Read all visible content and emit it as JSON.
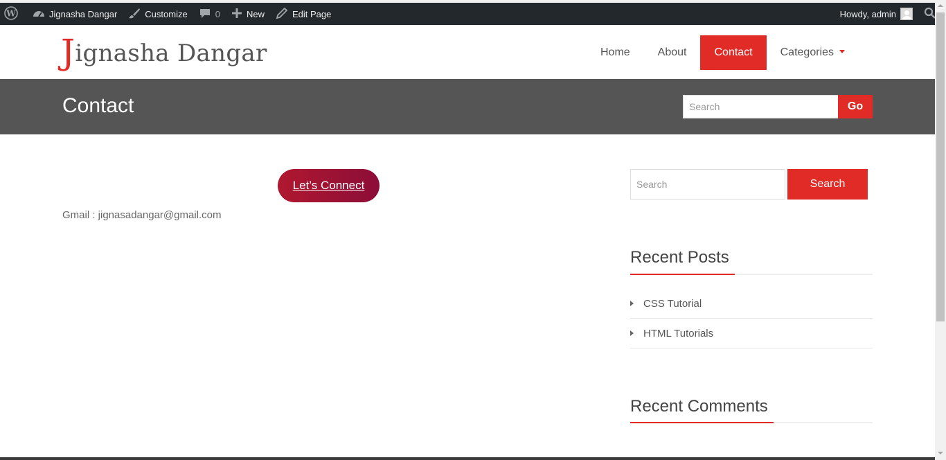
{
  "admin_bar": {
    "site_name": "Jignasha Dangar",
    "customize": "Customize",
    "comments_count": "0",
    "new_label": "New",
    "edit_page": "Edit Page",
    "howdy": "Howdy, admin"
  },
  "header": {
    "logo_first": "J",
    "logo_rest": "ignasha Dangar",
    "nav": [
      {
        "label": "Home"
      },
      {
        "label": "About"
      },
      {
        "label": "Contact",
        "active": true
      },
      {
        "label": "Categories"
      }
    ]
  },
  "title_bar": {
    "title": "Contact",
    "search_placeholder": "Search",
    "go_label": "Go"
  },
  "content": {
    "connect_label": "Let’s Connect",
    "gmail_text": "Gmail : jignasadangar@gmail.com"
  },
  "sidebar": {
    "search_placeholder": "Search",
    "search_button": "Search",
    "recent_posts_title": "Recent Posts",
    "recent_posts": [
      "CSS Tutorial",
      "HTML Tutorials"
    ],
    "recent_comments_title": "Recent Comments"
  },
  "colors": {
    "accent": "#e02b27",
    "admin_bar": "#23282d",
    "title_bar": "#555555",
    "connect_gradient_start": "#b0182f",
    "connect_gradient_end": "#8c0d38"
  }
}
